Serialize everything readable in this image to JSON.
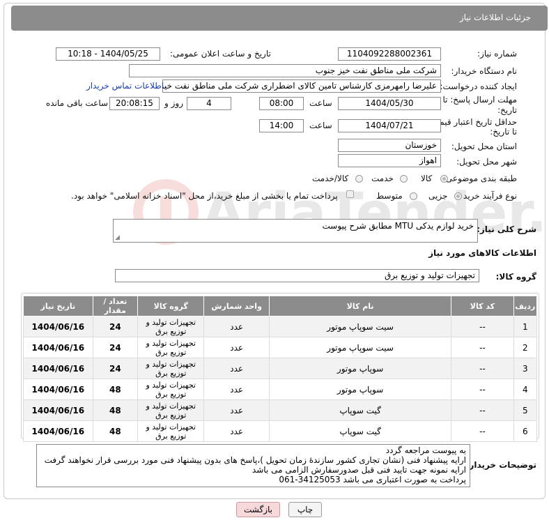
{
  "header": {
    "title": "جزئیات اطلاعات نیاز"
  },
  "form": {
    "need_number_label": "شماره نیاز:",
    "need_number": "1104092288002361",
    "announce_label": "تاریخ و ساعت اعلان عمومی:",
    "announce_value": "1404/05/25 - 10:18",
    "buyer_org_label": "نام دستگاه خریدار:",
    "buyer_org": "شرکت ملی مناطق نفت خیز جنوب",
    "requester_label": "ایجاد کننده درخواست:",
    "requester": "علیرضا رامهرمزی کارشناس تامین کالای اضطراری شرکت ملی مناطق نفت خیز جنوب",
    "contact_link": "اطلاعات تماس خریدار",
    "deadline_label_1": "مهلت ارسال پاسخ: تا",
    "deadline_label_2": "تاریخ:",
    "deadline_date": "1404/05/30",
    "time_label": "ساعت",
    "deadline_time": "08:00",
    "days_value": "4",
    "days_label": "روز و",
    "remaining_time": "20:08:15",
    "remaining_label": "ساعت باقی مانده",
    "min_price_label_1": "حداقل تاریخ اعتبار قیمت:",
    "min_price_label_2": "تا تاریخ:",
    "price_date": "1404/07/21",
    "price_time_label": "ساعت",
    "price_time": "14:00",
    "province_label": "استان محل تحویل:",
    "province": "خوزستان",
    "city_label": "شهر محل تحویل:",
    "city": "اهواز",
    "category_label": "طبقه بندی موضوعی:",
    "category_options": [
      "کالا",
      "خدمت",
      "کالا/خدمت"
    ],
    "process_label": "نوع فرآیند خرید :",
    "process_options": [
      "جزیی",
      "متوسط"
    ],
    "payment_note": "پرداخت تمام یا بخشی از مبلغ خرید،از محل \"اسناد خزانه اسلامی\" خواهد بود."
  },
  "summary": {
    "label": "شرح کلی نیاز:",
    "value": "خرید لوازم یدکی MTU مطابق شرح پیوست"
  },
  "goods": {
    "title": "اطلاعات کالاهای مورد نیاز",
    "group_label": "گروه کالا:",
    "group_value": "تجهیزات تولید و توزیع برق",
    "columns": [
      "ردیف",
      "کد کالا",
      "نام کالا",
      "واحد شمارش",
      "گروه کالا",
      "تعداد / مقدار",
      "تاریخ نیاز"
    ],
    "rows": [
      {
        "row": "1",
        "code": "--",
        "name": "سیت سوپاپ موتور",
        "unit": "عدد",
        "group": "تجهیزات تولید و توزیع برق",
        "qty": "24",
        "date": "1404/06/16"
      },
      {
        "row": "2",
        "code": "--",
        "name": "سیت سوپاپ موتور",
        "unit": "عدد",
        "group": "تجهیزات تولید و توزیع برق",
        "qty": "24",
        "date": "1404/06/16"
      },
      {
        "row": "3",
        "code": "--",
        "name": "سوپاپ موتور",
        "unit": "عدد",
        "group": "تجهیزات تولید و توزیع برق",
        "qty": "24",
        "date": "1404/06/16"
      },
      {
        "row": "4",
        "code": "--",
        "name": "سوپاپ موتور",
        "unit": "عدد",
        "group": "تجهیزات تولید و توزیع برق",
        "qty": "48",
        "date": "1404/06/16"
      },
      {
        "row": "5",
        "code": "--",
        "name": "گیت سوپاپ",
        "unit": "عدد",
        "group": "تجهیزات تولید و توزیع برق",
        "qty": "48",
        "date": "1404/06/16"
      },
      {
        "row": "6",
        "code": "--",
        "name": "گیت سوپاپ",
        "unit": "عدد",
        "group": "تجهیزات تولید و توزیع برق",
        "qty": "48",
        "date": "1404/06/16"
      }
    ]
  },
  "buyer_notes": {
    "label": "توضیحات خریدار:",
    "lines": [
      "به پیوست مراجعه گردد",
      "ارایه پیشنهاد فنی (نشان تجاری کشور سازندهٔ زمان تحویل )،پاسخ های بدون پیشنهاد فنی مورد بررسی قرار نخواهند گرفت",
      "ارایه نمونه جهت تایید فنی قبل صدورسفارش الزامی می باشد",
      "پرداخت به صورت اعتباری می باشد 34125053-061"
    ]
  },
  "buttons": {
    "print": "چاپ",
    "back": "بازگشت"
  },
  "watermark": {
    "text": "AriaTender.neT"
  }
}
